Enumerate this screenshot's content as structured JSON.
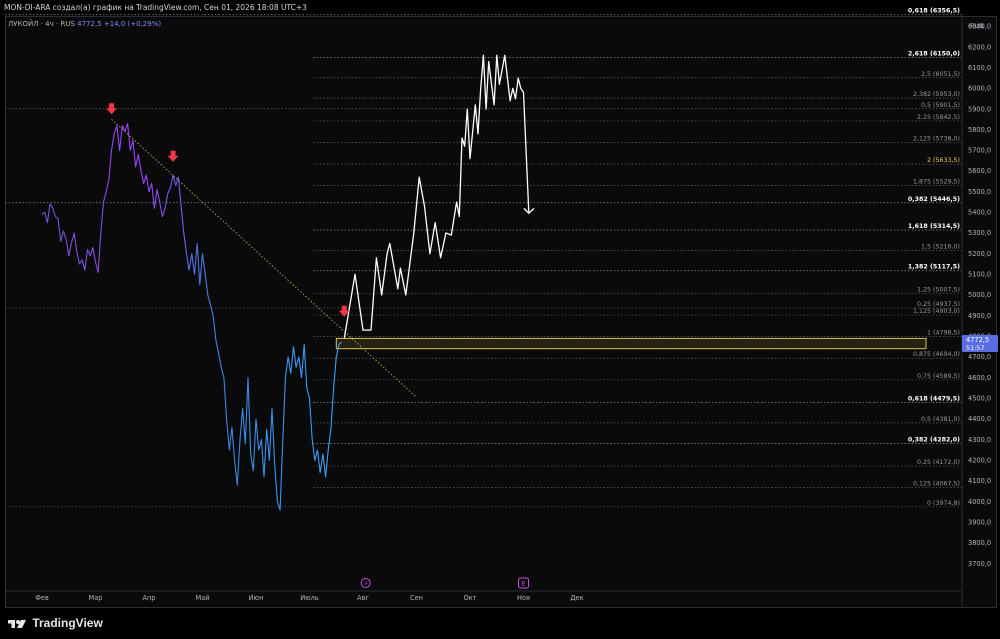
{
  "header": {
    "attribution": "MON-DI-ARA создал(а) график на TradingView.com, Сен 01, 2026 18:08 UTC+3"
  },
  "legend": {
    "ticker": "ЛУКОЙЛ · 4ч · RUS",
    "price": "4772,5",
    "change": "+14,0 (+0,29%)"
  },
  "footer": {
    "brand": "TradingView"
  },
  "price_scale": {
    "currency": "RUB",
    "ticks": [
      "6300,0",
      "6200,0",
      "6100,0",
      "6000,0",
      "5900,0",
      "5800,0",
      "5700,0",
      "5600,0",
      "5500,0",
      "5400,0",
      "5300,0",
      "5200,0",
      "5100,0",
      "5000,0",
      "4900,0",
      "4800,0",
      "4700,0",
      "4600,0",
      "4500,0",
      "4400,0",
      "4300,0",
      "4200,0",
      "4100,0",
      "4000,0",
      "3900,0",
      "3800,0",
      "3700,0"
    ],
    "last_price_label": "4772,5",
    "countdown_label": "51:57"
  },
  "time_scale": {
    "ticks": [
      "Фев",
      "Мар",
      "Апр",
      "Май",
      "Июн",
      "Июль",
      "Авг",
      "Сен",
      "Окт",
      "Ноя",
      "Дек"
    ],
    "event_icons": [
      "⚡",
      "E"
    ]
  },
  "fib_levels": [
    {
      "text": "0,618 (6356,5)",
      "price": 6356.5,
      "color": "#ffffff",
      "bold": true,
      "x0": 0
    },
    {
      "text": "2,618 (6150,0)",
      "price": 6150.0,
      "color": "#ffffff",
      "bold": true,
      "x0": 308
    },
    {
      "text": "2,5 (6051,5)",
      "price": 6051.5,
      "color": "#9598a1",
      "bold": false,
      "x0": 308
    },
    {
      "text": "2,382 (5953,0)",
      "price": 5953.0,
      "color": "#9598a1",
      "bold": false,
      "x0": 308
    },
    {
      "text": "0,5 (5901,5)",
      "price": 5901.5,
      "color": "#9598a1",
      "bold": false,
      "x0": 0
    },
    {
      "text": "2,25 (5842,5)",
      "price": 5842.5,
      "color": "#9598a1",
      "bold": false,
      "x0": 308
    },
    {
      "text": "2,125 (5738,0)",
      "price": 5738.0,
      "color": "#9598a1",
      "bold": false,
      "x0": 308
    },
    {
      "text": "2 (5633,5)",
      "price": 5633.5,
      "color": "#f0d34a",
      "bold": false,
      "x0": 308
    },
    {
      "text": "1,875 (5529,5)",
      "price": 5529.5,
      "color": "#9598a1",
      "bold": false,
      "x0": 308
    },
    {
      "text": "0,382 (5446,5)",
      "price": 5446.5,
      "color": "#ffffff",
      "bold": true,
      "x0": 0
    },
    {
      "text": "1,618 (5314,5)",
      "price": 5314.5,
      "color": "#ffffff",
      "bold": true,
      "x0": 308
    },
    {
      "text": "1,5 (5216,0)",
      "price": 5216.0,
      "color": "#9598a1",
      "bold": false,
      "x0": 308
    },
    {
      "text": "1,382 (5117,5)",
      "price": 5117.5,
      "color": "#ffffff",
      "bold": true,
      "x0": 308
    },
    {
      "text": "1,25 (5007,5)",
      "price": 5007.5,
      "color": "#9598a1",
      "bold": false,
      "x0": 308
    },
    {
      "text": "0,25 (4937,5)",
      "price": 4937.5,
      "color": "#9598a1",
      "bold": false,
      "x0": 0
    },
    {
      "text": "1,125 (4903,0)",
      "price": 4903.0,
      "color": "#9598a1",
      "bold": false,
      "x0": 308
    },
    {
      "text": "1 (4798,5)",
      "price": 4798.5,
      "color": "#9598a1",
      "bold": false,
      "x0": 308
    },
    {
      "text": "0,875 (4694,0)",
      "price": 4694.0,
      "color": "#9598a1",
      "bold": false,
      "x0": 308
    },
    {
      "text": "0,75 (4589,5)",
      "price": 4589.5,
      "color": "#9598a1",
      "bold": false,
      "x0": 308
    },
    {
      "text": "0,618 (4479,5)",
      "price": 4479.5,
      "color": "#ffffff",
      "bold": true,
      "x0": 308
    },
    {
      "text": "0,5 (4381,0)",
      "price": 4381.0,
      "color": "#9598a1",
      "bold": false,
      "x0": 308
    },
    {
      "text": "0,382 (4282,0)",
      "price": 4282.0,
      "color": "#ffffff",
      "bold": true,
      "x0": 308
    },
    {
      "text": "0,25 (4172,0)",
      "price": 4172.0,
      "color": "#9598a1",
      "bold": false,
      "x0": 308
    },
    {
      "text": "0,125 (4067,5)",
      "price": 4067.5,
      "color": "#9598a1",
      "bold": false,
      "x0": 308
    },
    {
      "text": "0 (3974,8)",
      "price": 3974.8,
      "color": "#9598a1",
      "bold": false,
      "x0": 0
    }
  ],
  "colors": {
    "background": "#0a0a0a",
    "projection": "#ffffff",
    "zone": "#f0d34a",
    "arrows": "#f23645",
    "trendline": "#d4b94a",
    "accent": "#5b6ee1"
  },
  "chart_data": {
    "type": "line",
    "title": "ЛУКОЙЛ · 4ч · RUS",
    "xlabel": "",
    "ylabel": "",
    "ylim": [
      3650,
      6450
    ],
    "x_axis": "months 2026 (Feb → Dec)",
    "series": [
      {
        "name": "ЛУКОЙЛ",
        "gradient": [
          "#6a5acd",
          "#a040ff",
          "#3d7fe0",
          "#35a6ff"
        ],
        "points": [
          [
            1.0,
            5390
          ],
          [
            1.05,
            5400
          ],
          [
            1.1,
            5350
          ],
          [
            1.15,
            5440
          ],
          [
            1.2,
            5420
          ],
          [
            1.25,
            5380
          ],
          [
            1.3,
            5370
          ],
          [
            1.35,
            5260
          ],
          [
            1.4,
            5310
          ],
          [
            1.45,
            5270
          ],
          [
            1.5,
            5190
          ],
          [
            1.55,
            5250
          ],
          [
            1.6,
            5300
          ],
          [
            1.65,
            5210
          ],
          [
            1.7,
            5150
          ],
          [
            1.75,
            5170
          ],
          [
            1.8,
            5120
          ],
          [
            1.85,
            5220
          ],
          [
            1.9,
            5190
          ],
          [
            1.95,
            5230
          ],
          [
            2.0,
            5160
          ],
          [
            2.05,
            5110
          ],
          [
            2.1,
            5300
          ],
          [
            2.15,
            5450
          ],
          [
            2.2,
            5500
          ],
          [
            2.25,
            5560
          ],
          [
            2.3,
            5700
          ],
          [
            2.35,
            5780
          ],
          [
            2.4,
            5820
          ],
          [
            2.45,
            5700
          ],
          [
            2.5,
            5820
          ],
          [
            2.55,
            5790
          ],
          [
            2.6,
            5830
          ],
          [
            2.65,
            5700
          ],
          [
            2.7,
            5750
          ],
          [
            2.75,
            5620
          ],
          [
            2.8,
            5680
          ],
          [
            2.85,
            5600
          ],
          [
            2.9,
            5540
          ],
          [
            2.95,
            5580
          ],
          [
            3.0,
            5500
          ],
          [
            3.05,
            5540
          ],
          [
            3.1,
            5420
          ],
          [
            3.15,
            5510
          ],
          [
            3.2,
            5450
          ],
          [
            3.25,
            5380
          ],
          [
            3.3,
            5420
          ],
          [
            3.35,
            5490
          ],
          [
            3.4,
            5520
          ],
          [
            3.45,
            5580
          ],
          [
            3.5,
            5530
          ],
          [
            3.55,
            5570
          ],
          [
            3.6,
            5430
          ],
          [
            3.65,
            5300
          ],
          [
            3.7,
            5200
          ],
          [
            3.75,
            5120
          ],
          [
            3.8,
            5200
          ],
          [
            3.85,
            5100
          ],
          [
            3.9,
            5250
          ],
          [
            3.95,
            5050
          ],
          [
            4.0,
            5200
          ],
          [
            4.05,
            5100
          ],
          [
            4.1,
            5000
          ],
          [
            4.15,
            4950
          ],
          [
            4.2,
            4900
          ],
          [
            4.25,
            4780
          ],
          [
            4.3,
            4720
          ],
          [
            4.35,
            4650
          ],
          [
            4.4,
            4600
          ],
          [
            4.45,
            4400
          ],
          [
            4.5,
            4250
          ],
          [
            4.55,
            4360
          ],
          [
            4.6,
            4200
          ],
          [
            4.65,
            4080
          ],
          [
            4.7,
            4300
          ],
          [
            4.75,
            4450
          ],
          [
            4.8,
            4280
          ],
          [
            4.85,
            4600
          ],
          [
            4.9,
            4230
          ],
          [
            4.95,
            4150
          ],
          [
            5.0,
            4400
          ],
          [
            5.05,
            4250
          ],
          [
            5.1,
            4300
          ],
          [
            5.15,
            4120
          ],
          [
            5.2,
            4350
          ],
          [
            5.25,
            4200
          ],
          [
            5.3,
            4450
          ],
          [
            5.35,
            4180
          ],
          [
            5.4,
            4000
          ],
          [
            5.45,
            3960
          ],
          [
            5.5,
            4300
          ],
          [
            5.55,
            4600
          ],
          [
            5.6,
            4700
          ],
          [
            5.65,
            4620
          ],
          [
            5.7,
            4750
          ],
          [
            5.75,
            4650
          ],
          [
            5.8,
            4700
          ],
          [
            5.85,
            4600
          ],
          [
            5.9,
            4760
          ],
          [
            5.95,
            4550
          ],
          [
            6.0,
            4500
          ],
          [
            6.05,
            4300
          ],
          [
            6.1,
            4200
          ],
          [
            6.15,
            4250
          ],
          [
            6.2,
            4140
          ],
          [
            6.25,
            4230
          ],
          [
            6.3,
            4120
          ],
          [
            6.35,
            4250
          ],
          [
            6.4,
            4350
          ],
          [
            6.45,
            4550
          ],
          [
            6.5,
            4700
          ],
          [
            6.55,
            4760
          ],
          [
            6.6,
            4772.5
          ]
        ]
      },
      {
        "name": "",
        "points": [
          [
            6.65,
            4790
          ],
          [
            6.85,
            5100
          ],
          [
            7.0,
            4830
          ],
          [
            7.15,
            4830
          ],
          [
            7.25,
            5180
          ],
          [
            7.35,
            5000
          ],
          [
            7.45,
            5200
          ],
          [
            7.5,
            5250
          ],
          [
            7.65,
            5030
          ],
          [
            7.7,
            5130
          ],
          [
            7.8,
            5000
          ],
          [
            7.95,
            5300
          ],
          [
            8.05,
            5570
          ],
          [
            8.15,
            5430
          ],
          [
            8.25,
            5200
          ],
          [
            8.35,
            5350
          ],
          [
            8.45,
            5180
          ],
          [
            8.55,
            5300
          ],
          [
            8.65,
            5290
          ],
          [
            8.75,
            5450
          ],
          [
            8.8,
            5380
          ],
          [
            8.85,
            5760
          ],
          [
            8.9,
            5720
          ],
          [
            8.95,
            5900
          ],
          [
            9.0,
            5660
          ],
          [
            9.1,
            5920
          ],
          [
            9.15,
            5780
          ],
          [
            9.2,
            6000
          ],
          [
            9.25,
            6160
          ],
          [
            9.3,
            5900
          ],
          [
            9.35,
            6130
          ],
          [
            9.45,
            5920
          ],
          [
            9.5,
            6160
          ],
          [
            9.55,
            6020
          ],
          [
            9.65,
            6160
          ],
          [
            9.75,
            5940
          ],
          [
            9.8,
            6000
          ],
          [
            9.85,
            5950
          ],
          [
            9.9,
            6050
          ],
          [
            9.95,
            6000
          ],
          [
            10.0,
            5980
          ],
          [
            10.1,
            5400
          ]
        ]
      }
    ],
    "annotations": {
      "arrows_down_at": [
        [
          2.3,
          5880
        ],
        [
          3.45,
          5650
        ],
        [
          6.65,
          4900
        ]
      ],
      "zone": {
        "x": [
          6.65,
          11.6
        ],
        "y": [
          4740,
          4790
        ]
      },
      "trendline": {
        "from": [
          2.3,
          5850
        ],
        "to": [
          8.0,
          4505
        ]
      }
    }
  }
}
